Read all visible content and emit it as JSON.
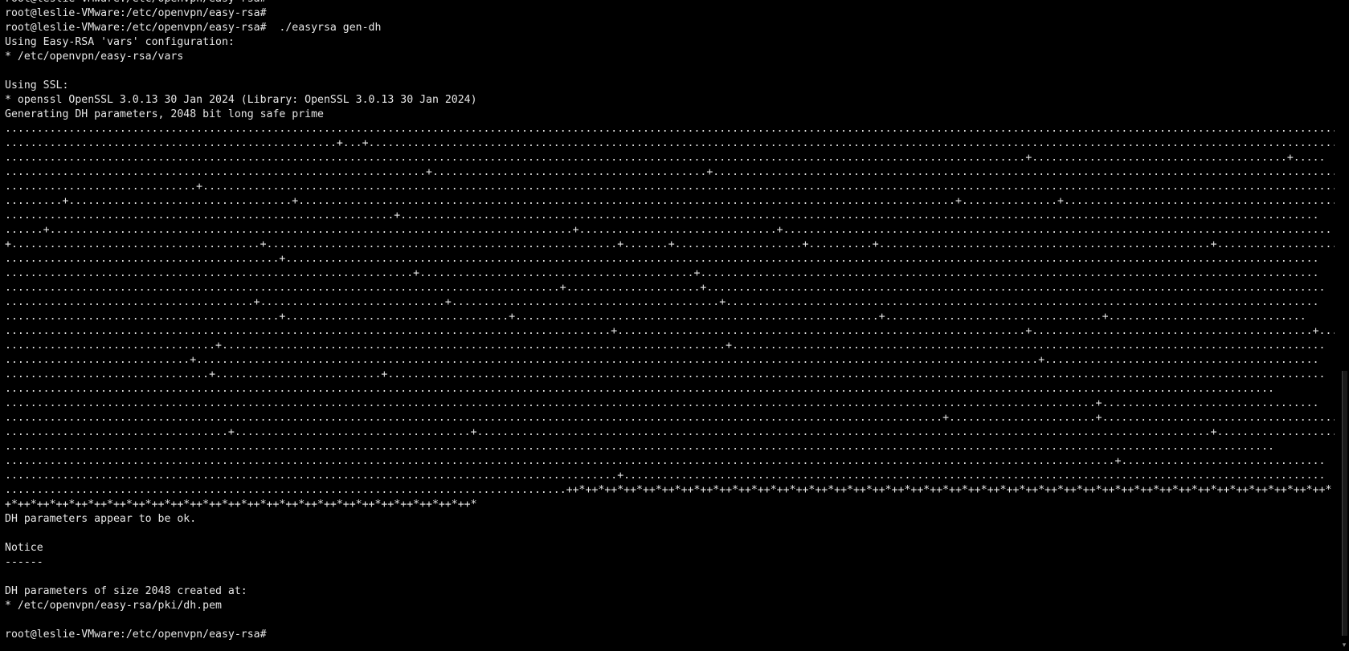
{
  "terminal": {
    "lines": [
      "root@leslie-VMware:/etc/openvpn/easy-rsa#",
      "root@leslie-VMware:/etc/openvpn/easy-rsa#",
      "root@leslie-VMware:/etc/openvpn/easy-rsa#  ./easyrsa gen-dh",
      "Using Easy-RSA 'vars' configuration:",
      "* /etc/openvpn/easy-rsa/vars",
      "",
      "Using SSL:",
      "* openssl OpenSSL 3.0.13 30 Jan 2024 (Library: OpenSSL 3.0.13 30 Jan 2024)",
      "Generating DH parameters, 2048 bit long safe prime",
      ".......................................................................................................................................................................................................................",
      "....................................................+...+.............................................................................................................................................................",
      "................................................................................................................................................................+........................................+.....",
      "..................................................................+...........................................+........................................................................................................",
      "..............................+...........................................................................................................................................................................................",
      ".........+...................................+.......................................................................................................+...............+............................................",
      ".............................................................+................................................................................................................................................",
      "......+..................................................................................+...............................+......................................................................................",
      "+.......................................+.......................................................+.......+....................+..........+....................................................+..........................",
      "...........................................+..................................................................................................................................................................",
      "................................................................+...........................................+.................................................................................................",
      ".......................................................................................+.....................+.................................................................................................",
      ".......................................+.............................+..........................................+.............................................................................................",
      "...........................................+...................................+.........................................................+..................................+...............................",
      "...............................................................................................+................................................................+............................................+.....",
      ".................................+...............................................................................+.............................................................................................",
      ".............................+....................................................................................................................................+...........................................",
      "................................+..........................+...................................................................................................................................................",
      ".......................................................................................................................................................................................................",
      "...........................................................................................................................................................................+..................................",
      "...................................................................................................................................................+.......................+......................................",
      "...................................+.....................................+...................................................................................................................+....................",
      ".......................................................................................................................................................................................................",
      "..............................................................................................................................................................................+................................",
      "................................................................................................+..............................................................................................................",
      "........................................................................................++*++*++*++*++*++*++*++*++*++*++*++*++*++*++*++*++*++*++*++*++*++*++*++*++*++*++*++*++*++*++*++*++*++*++*++*++*++*++*++*",
      "+*++*++*++*++*++*++*++*++*++*++*++*++*++*++*++*++*++*++*++*++*++*++*++*++*",
      "DH parameters appear to be ok.",
      "",
      "Notice",
      "------",
      "",
      "DH parameters of size 2048 created at:",
      "* /etc/openvpn/easy-rsa/pki/dh.pem",
      "",
      "root@leslie-VMware:/etc/openvpn/easy-rsa#"
    ]
  },
  "colors": {
    "background": "#000000",
    "foreground": "#e6e6e6"
  },
  "scrollbar": {
    "arrow_icon": "chevron-down-icon"
  }
}
